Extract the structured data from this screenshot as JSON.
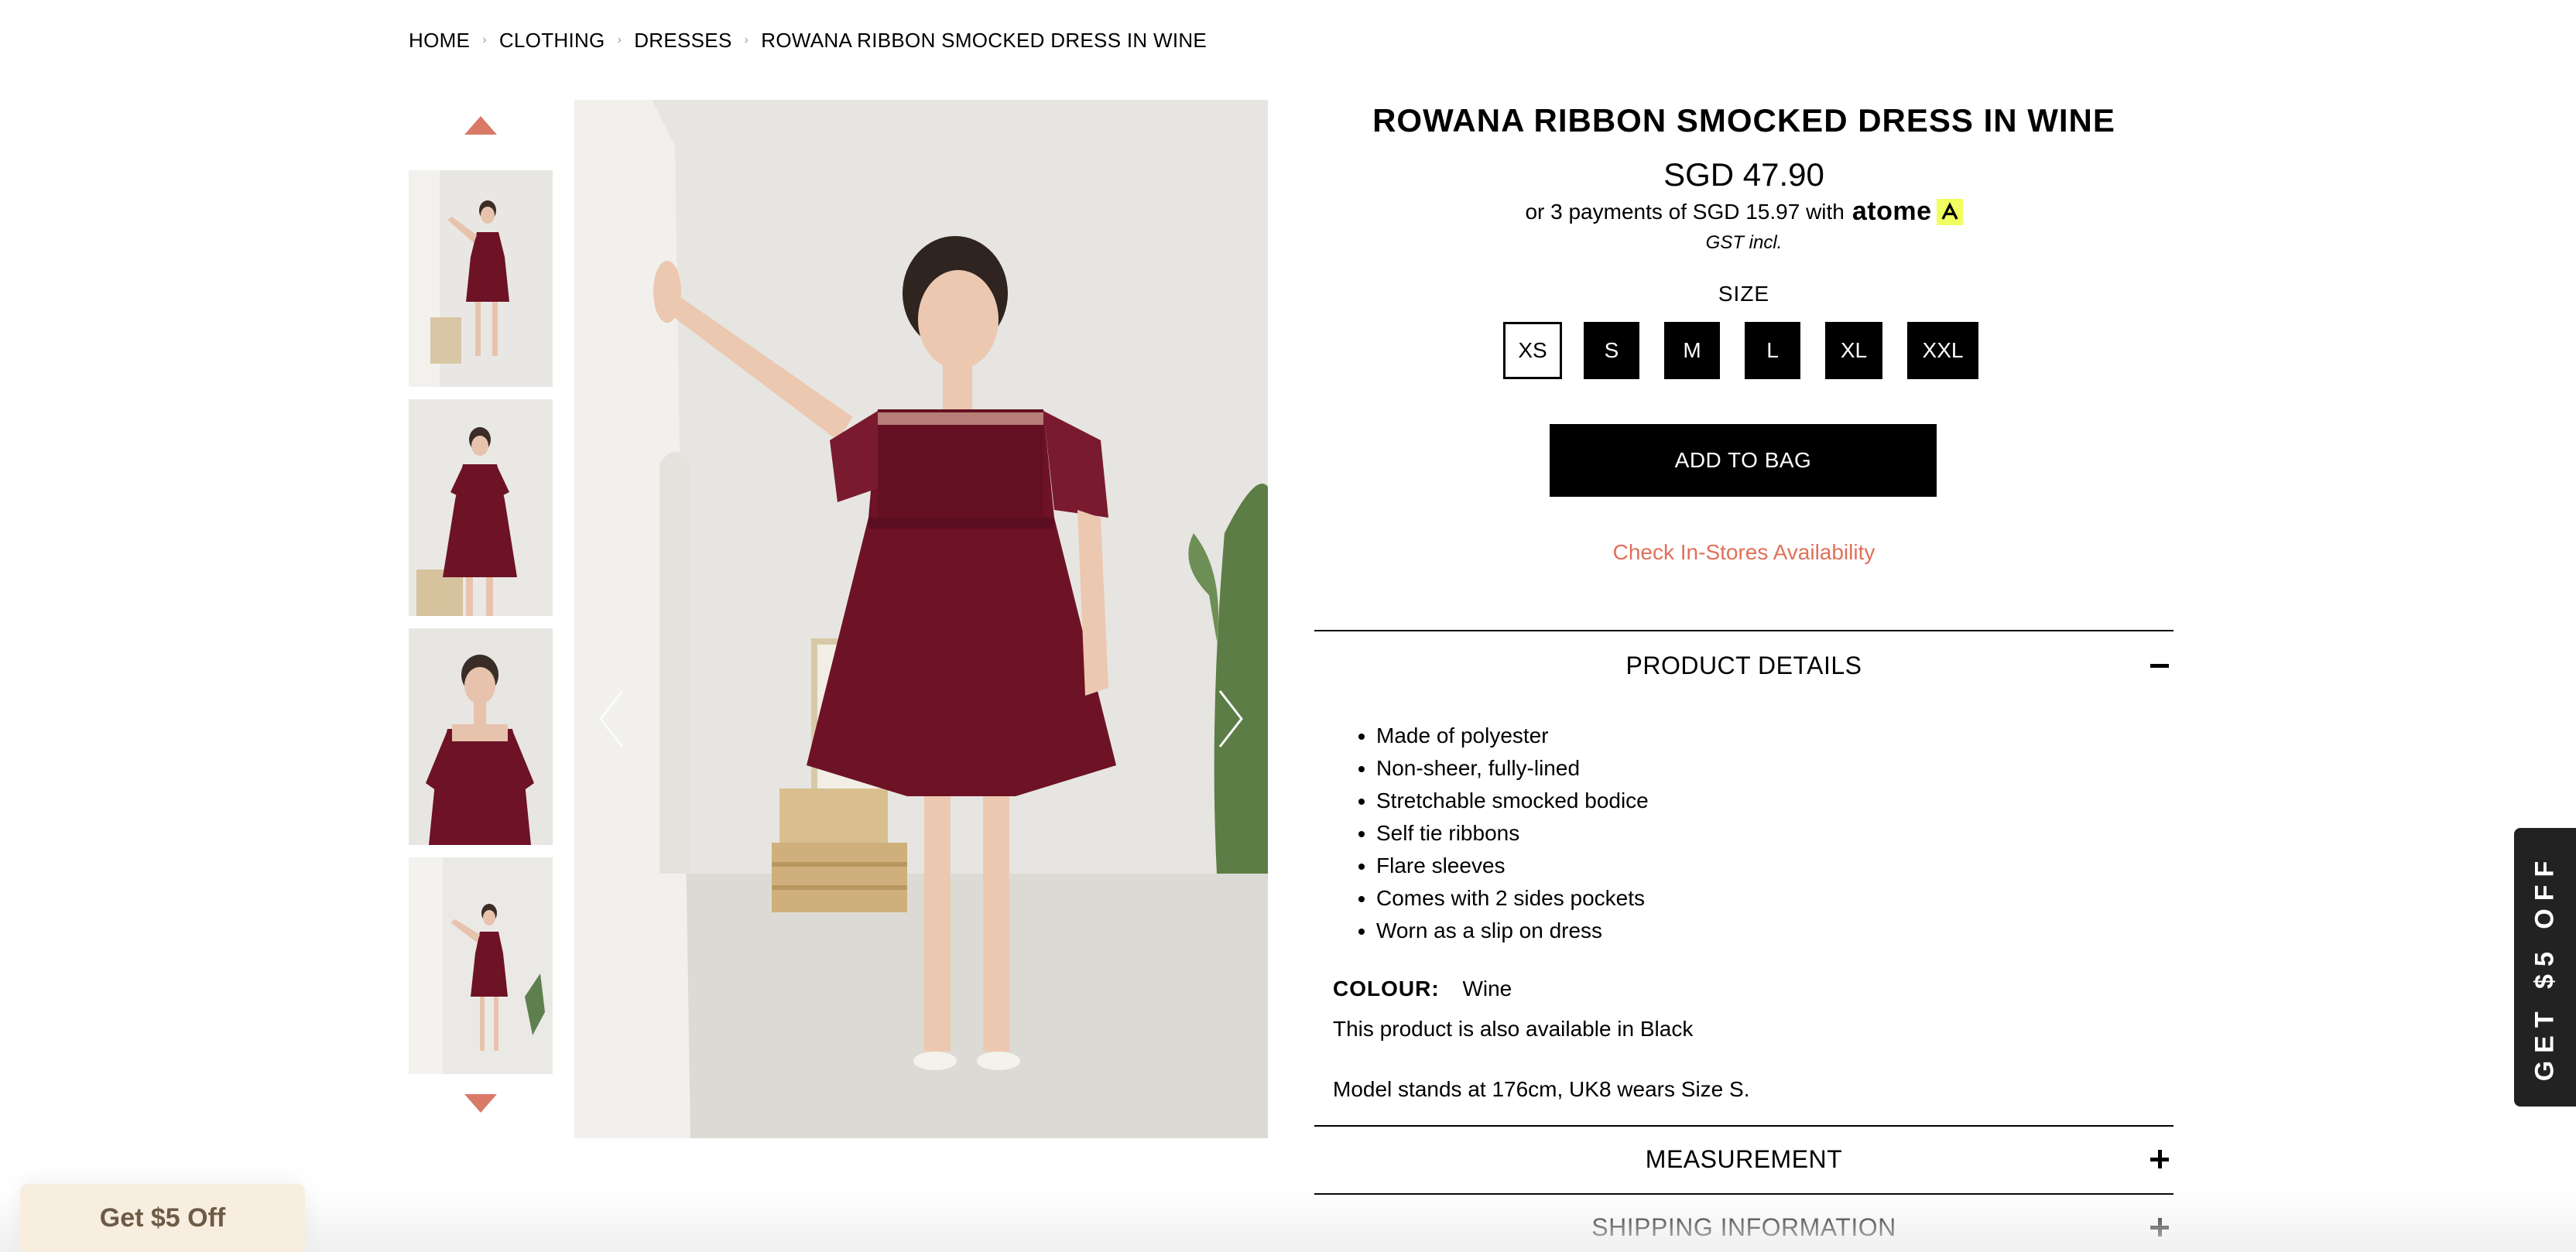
{
  "breadcrumb": [
    {
      "label": "HOME"
    },
    {
      "label": "CLOTHING"
    },
    {
      "label": "DRESSES"
    },
    {
      "label": "ROWANA RIBBON SMOCKED DRESS IN WINE"
    }
  ],
  "gallery": {
    "thumbnail_count": 4,
    "arrow_color": "#d97a66",
    "dress_color": "#6e1226"
  },
  "product": {
    "title": "ROWANA RIBBON SMOCKED DRESS IN WINE",
    "price": "SGD 47.90",
    "installment_text": "or 3 payments of SGD 15.97 with",
    "installment_brand": "atome",
    "gst": "GST incl.",
    "size_label": "SIZE",
    "sizes": [
      {
        "label": "XS",
        "selected": true
      },
      {
        "label": "S",
        "selected": false
      },
      {
        "label": "M",
        "selected": false
      },
      {
        "label": "L",
        "selected": false
      },
      {
        "label": "XL",
        "selected": false
      },
      {
        "label": "XXL",
        "selected": false
      }
    ],
    "add_to_bag": "ADD TO BAG",
    "check_stores": "Check In-Stores Availability",
    "accent_color": "#e0705a"
  },
  "details": {
    "heading": "PRODUCT DETAILS",
    "expanded": true,
    "items": [
      "Made of polyester",
      "Non-sheer, fully-lined",
      "Stretchable smocked bodice",
      "Self tie ribbons",
      "Flare sleeves",
      "Comes with 2 sides pockets",
      "Worn as a slip on dress"
    ],
    "colour_label": "COLOUR:",
    "colour_value": "Wine",
    "also_available": "This product is also available in Black",
    "model_info": "Model stands at 176cm, UK8 wears Size S."
  },
  "measurement": {
    "heading": "MEASUREMENT"
  },
  "shipping": {
    "heading": "SHIPPING INFORMATION"
  },
  "side_tab": {
    "label": "GET $5 OFF"
  },
  "promo": {
    "label": "Get $5 Off"
  }
}
